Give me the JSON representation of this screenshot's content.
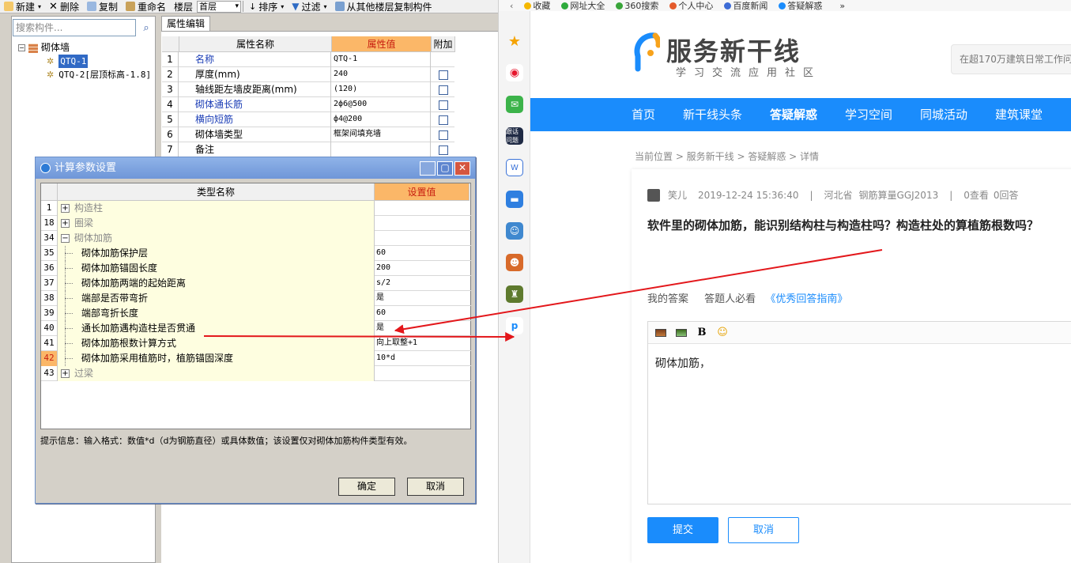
{
  "toolbar": {
    "new": "新建",
    "delete": "删除",
    "copy": "复制",
    "rename": "重命名",
    "floor_label": "楼层",
    "floor_value": "首层",
    "sort": "排序",
    "filter": "过滤",
    "copy_from_floor": "从其他楼层复制构件"
  },
  "tree": {
    "search_placeholder": "搜索构件...",
    "root": "砌体墙",
    "items": [
      "QTQ-1",
      "QTQ-2[层顶标高-1.8]"
    ]
  },
  "props": {
    "tab": "属性编辑",
    "headers": [
      "属性名称",
      "属性值",
      "附加"
    ],
    "rows": [
      {
        "num": "1",
        "name": "名称",
        "value": "QTQ-1"
      },
      {
        "num": "2",
        "name": "厚度(mm)",
        "value": "240"
      },
      {
        "num": "3",
        "name": "轴线距左墙皮距离(mm)",
        "value": "(120)"
      },
      {
        "num": "4",
        "name": "砌体通长筋",
        "value": "2ф6@500"
      },
      {
        "num": "5",
        "name": "横向短筋",
        "value": "ф4@200"
      },
      {
        "num": "6",
        "name": "砌体墙类型",
        "value": "框架间填充墙"
      },
      {
        "num": "7",
        "name": "备注",
        "value": ""
      }
    ]
  },
  "dialog": {
    "title": "计算参数设置",
    "headers": [
      "类型名称",
      "设置值"
    ],
    "rows": [
      {
        "num": "1",
        "name": "构造柱",
        "value": ""
      },
      {
        "num": "18",
        "name": "圈梁",
        "value": ""
      },
      {
        "num": "34",
        "name": "砌体加筋",
        "value": ""
      },
      {
        "num": "35",
        "name": "砌体加筋保护层",
        "value": "60"
      },
      {
        "num": "36",
        "name": "砌体加筋锚固长度",
        "value": "200"
      },
      {
        "num": "37",
        "name": "砌体加筋两端的起始距离",
        "value": "s/2"
      },
      {
        "num": "38",
        "name": "端部是否带弯折",
        "value": "是"
      },
      {
        "num": "39",
        "name": "端部弯折长度",
        "value": "60"
      },
      {
        "num": "40",
        "name": "通长加筋遇构造柱是否贯通",
        "value": "是"
      },
      {
        "num": "41",
        "name": "砌体加筋根数计算方式",
        "value": "向上取整+1"
      },
      {
        "num": "42",
        "name": "砌体加筋采用植筋时，植筋锚固深度",
        "value": "10*d"
      },
      {
        "num": "43",
        "name": "过梁",
        "value": ""
      }
    ],
    "hint": "提示信息：输入格式：数值*d（d为钢筋直径）或具体数值；该设置仅对砌体加筋构件类型有效。",
    "ok": "确定",
    "cancel": "取消"
  },
  "browser": {
    "bookmarks": [
      "收藏",
      "网址大全",
      "360搜索",
      "个人中心",
      "百度新闻",
      "答疑解惑"
    ],
    "site": {
      "logo_title": "服务新干线",
      "logo_sub": "学习交流应用社区",
      "search_placeholder": "在超170万建筑日常工作问"
    },
    "nav": [
      "首页",
      "新干线头条",
      "答疑解惑",
      "学习空间",
      "同城活动",
      "建筑课堂"
    ],
    "breadcrumb": "当前位置 > 服务新干线 > 答疑解惑 > 详情",
    "question": {
      "author": "笑儿",
      "date": "2019-12-24 15:36:40",
      "location": "河北省",
      "software": "钢筋算量GGJ2013",
      "views": "0查看",
      "answers": "0回答",
      "title": "软件里的砌体加筋，能识别结构柱与构造柱吗？构造柱处的算植筋根数吗？"
    },
    "answer": {
      "mine": "我的答案",
      "must_read": "答题人必看",
      "guide": "《优秀回答指南》",
      "content": "砌体加筋，",
      "submit": "提交",
      "cancel": "取消"
    },
    "rail_labels": [
      "跟话问题"
    ]
  },
  "colors": {
    "accent": "#1a8cfc",
    "arrow": "#e3171b",
    "header_highlight": "#fbb768"
  }
}
